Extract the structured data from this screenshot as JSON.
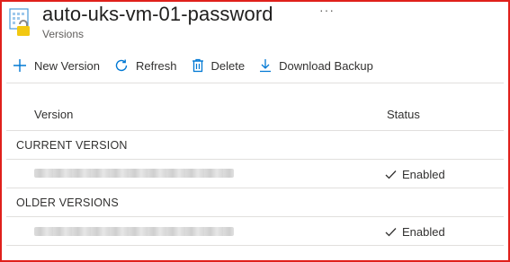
{
  "header": {
    "title": "auto-uks-vm-01-password",
    "subtitle": "Versions",
    "more": "···"
  },
  "toolbar": {
    "new_version": "New Version",
    "refresh": "Refresh",
    "delete": "Delete",
    "download_backup": "Download Backup"
  },
  "table": {
    "columns": [
      "Version",
      "Status"
    ],
    "sections": [
      {
        "label": "CURRENT VERSION",
        "rows": [
          {
            "status": "Enabled"
          }
        ]
      },
      {
        "label": "OLDER VERSIONS",
        "rows": [
          {
            "status": "Enabled"
          }
        ]
      }
    ]
  },
  "colors": {
    "accent": "#0078d4",
    "border": "#e0201b",
    "lock": "#f2c811"
  }
}
